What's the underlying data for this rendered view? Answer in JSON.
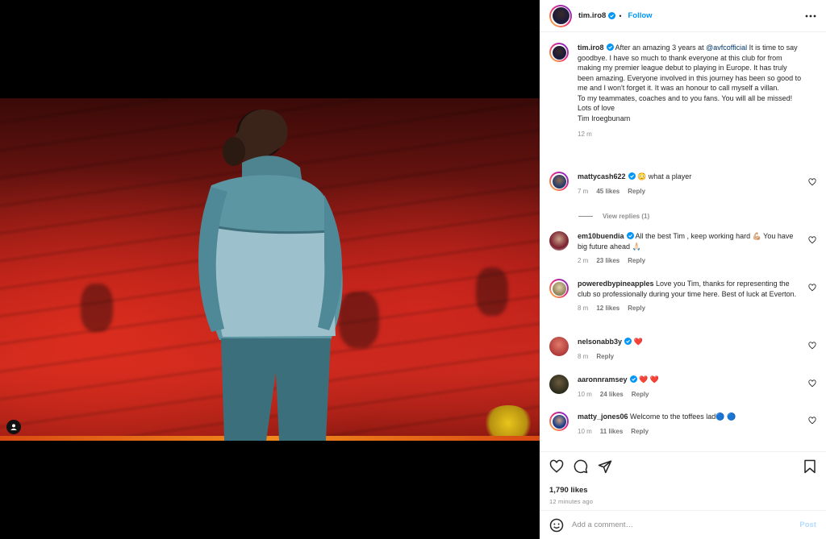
{
  "post": {
    "author": "tim.iro8",
    "follow_label": "Follow",
    "separator": "•",
    "caption": "After an amazing 3 years at",
    "caption_mention": "@avfcofficial",
    "caption_rest": " It is time to say goodbye. I have so much to thank everyone at this club for from making my premier league debut to playing in Europe. It has truly been amazing. Everyone involved in this journey has been so good to me and I won't forget it. It was an honour to call myself a villan.",
    "caption_line2": "To my teammates, coaches and to you fans. You will all be missed!",
    "caption_line3": "Lots of love",
    "caption_line4": "Tim Iroegbunam",
    "caption_time": "12 m"
  },
  "comments": [
    {
      "user": "mattycash622",
      "text": " 😳 what a player",
      "time": "7 m",
      "likes": "45 likes",
      "reply": "Reply"
    },
    {
      "user": "em10buendia",
      "text": " All the best Tim , keep working hard 💪🏼 You have big future ahead 🙏🏻",
      "time": "2 m",
      "likes": "23 likes",
      "reply": "Reply"
    },
    {
      "user": "poweredbypineapples",
      "text": " Love you Tim, thanks for representing the club so professionally during your time here. Best of luck at Everton.",
      "time": "8 m",
      "likes": "12 likes",
      "reply": "Reply"
    },
    {
      "user": "nelsonabb3y",
      "text": " ❤️",
      "time": "8 m",
      "reply": "Reply"
    },
    {
      "user": "aaronnramsey",
      "text": " ❤️ ❤️",
      "time": "10 m",
      "likes": "24 likes",
      "reply": "Reply"
    },
    {
      "user": "matty_jones06",
      "text": " Welcome to the toffees lad🔵 🔵",
      "time": "10 m",
      "likes": "11 likes",
      "reply": "Reply"
    }
  ],
  "view_replies": "View replies (1)",
  "likes_count": "1,790 likes",
  "posted_time": "12 minutes ago",
  "comment_box": {
    "placeholder": "Add a comment…",
    "post_label": "Post"
  },
  "colors": {
    "link": "#0095f6",
    "verified": "#0095f6",
    "heart": "#ed4956"
  },
  "icons": [
    "tag-user-icon",
    "more-options-icon",
    "verified-icon",
    "like-icon",
    "comment-icon",
    "share-icon",
    "save-icon",
    "emoji-icon"
  ]
}
